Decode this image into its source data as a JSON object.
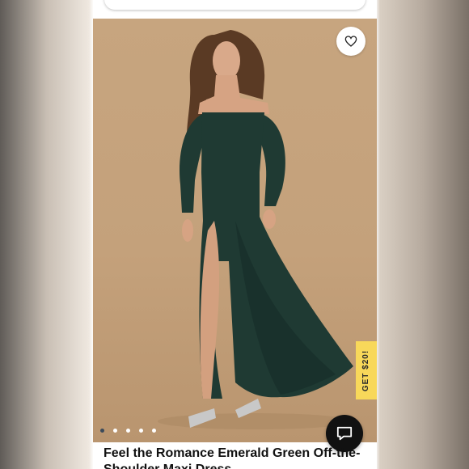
{
  "product": {
    "title": "Feel the Romance Emerald Green Off-the-Shoulder Maxi Dress",
    "image_alt": "Model wearing emerald green off-the-shoulder maxi dress",
    "dress_color": "#1f3a33"
  },
  "carousel": {
    "slide_count": 5,
    "active_index": 0
  },
  "promo": {
    "label": "GET $20!"
  },
  "icons": {
    "wishlist": "heart-icon",
    "chat": "chat-bubble-icon"
  },
  "colors": {
    "background": "#c4a17b",
    "promo": "#f8d85a",
    "chat_button": "#111111"
  }
}
